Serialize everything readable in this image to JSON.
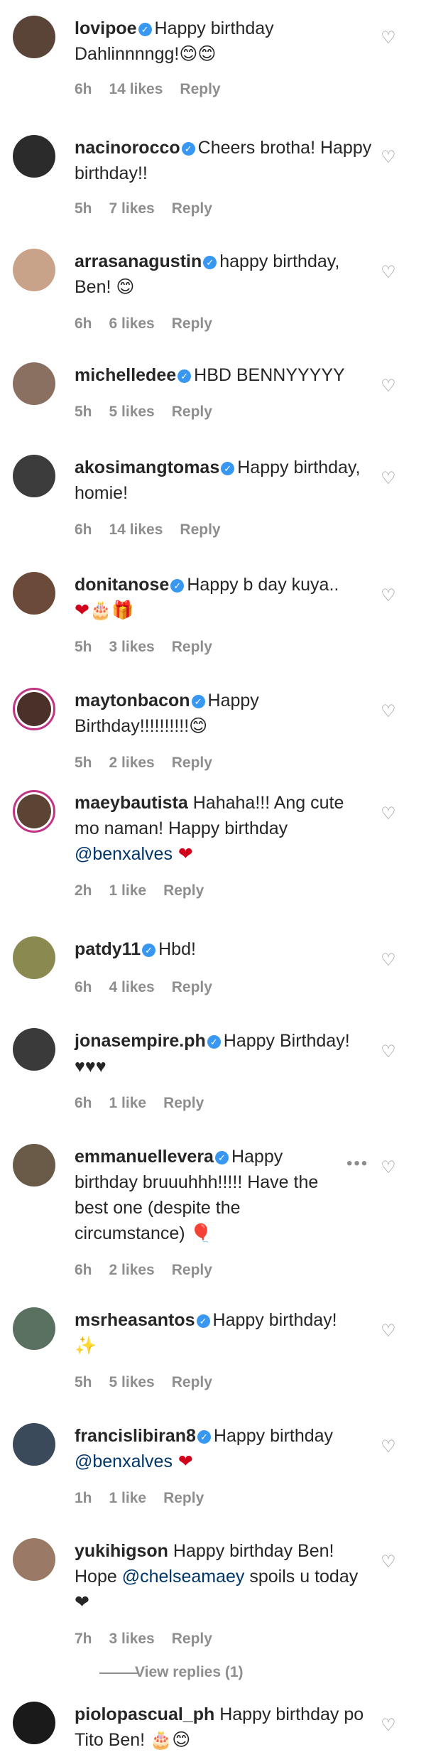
{
  "comments": [
    {
      "username": "lovipoe",
      "text": "Happy birthday Dahlinnnngg!😊😊",
      "time": "6h",
      "likes": "14 likes",
      "reply": "Reply",
      "avatar_color": "#5a4438"
    },
    {
      "username": "nacinorocco",
      "text": "Cheers brotha! Happy birthday!!",
      "time": "5h",
      "likes": "7 likes",
      "reply": "Reply",
      "avatar_color": "#2b2b2b"
    },
    {
      "username": "arrasanagustin",
      "text": "happy birthday, Ben! 😊",
      "time": "6h",
      "likes": "6 likes",
      "reply": "Reply",
      "avatar_color": "#c9a28a"
    },
    {
      "username": "michelledee",
      "text": "HBD BENNYYYYY",
      "time": "5h",
      "likes": "5 likes",
      "reply": "Reply",
      "avatar_color": "#8a7060"
    },
    {
      "username": "akosimangtomas",
      "text": "Happy birthday, homie!",
      "time": "6h",
      "likes": "14 likes",
      "reply": "Reply",
      "avatar_color": "#3c3c3c"
    },
    {
      "username": "donitanose",
      "text": "Happy b day kuya..",
      "text2": "❤🎂🎁",
      "time": "5h",
      "likes": "3 likes",
      "reply": "Reply",
      "avatar_color": "#6b4a3a"
    },
    {
      "username": "maytonbacon",
      "text": "Happy Birthday!!!!!!!!!!😊",
      "time": "5h",
      "likes": "2 likes",
      "reply": "Reply",
      "avatar_color": "#4a3028"
    },
    {
      "username": "maeybautista",
      "text_before": "Hahaha!!! Ang cute mo naman! Happy birthday ",
      "mention": "@benxalves",
      "text_after": " ❤",
      "time": "2h",
      "likes": "1 like",
      "reply": "Reply",
      "avatar_color": "#5c4434"
    },
    {
      "username": "patdy11",
      "text": "Hbd!",
      "time": "6h",
      "likes": "4 likes",
      "reply": "Reply",
      "avatar_color": "#8a8a50"
    },
    {
      "username": "jonasempire.ph",
      "text": "Happy Birthday! ♥♥♥",
      "time": "6h",
      "likes": "1 like",
      "reply": "Reply",
      "avatar_color": "#3a3a3a"
    },
    {
      "username": "emmanuellevera",
      "text": "Happy birthday bruuuhhh!!!!! Have the best one (despite the circumstance) 🎈",
      "time": "6h",
      "likes": "2 likes",
      "reply": "Reply",
      "more": "•••",
      "avatar_color": "#6a5a48"
    },
    {
      "username": "msrheasantos",
      "text": "Happy birthday!",
      "text2": "✨",
      "time": "5h",
      "likes": "5 likes",
      "reply": "Reply",
      "avatar_color": "#5a7060"
    },
    {
      "username": "francislibiran8",
      "text_before": "Happy birthday ",
      "mention": "@benxalves",
      "text_after": " ❤",
      "time": "1h",
      "likes": "1 like",
      "reply": "Reply",
      "avatar_color": "#3a4a5a"
    },
    {
      "username": "yukihigson",
      "text_before": "Happy birthday Ben! Hope ",
      "mention": "@chelseamaey",
      "text_after": " spoils u today ❤",
      "time": "7h",
      "likes": "3 likes",
      "reply": "Reply",
      "avatar_color": "#9a7a66"
    },
    {
      "username": "piolopascual_ph",
      "text": "Happy birthday po Tito Ben! 🎂😊",
      "avatar_color": "#1a1a1a"
    }
  ],
  "view_replies": "View replies (1)",
  "icons": {
    "heart": "heart-outline-icon",
    "verified": "verified-badge-icon",
    "more": "more-options-icon"
  },
  "colors": {
    "verified": "#3897f0",
    "ring": "#c13584",
    "mention": "#003569",
    "meta": "#8e8e8e"
  }
}
